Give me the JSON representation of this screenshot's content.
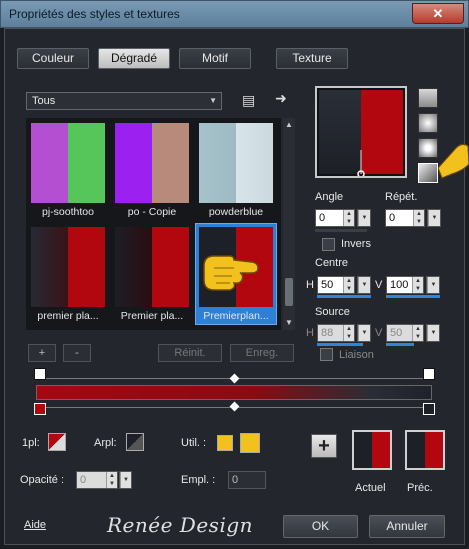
{
  "window": {
    "title": "Propriétés des styles et textures",
    "close_glyph": "✕"
  },
  "tabs": [
    {
      "label": "Couleur"
    },
    {
      "label": "Dégradé"
    },
    {
      "label": "Motif"
    },
    {
      "label": "Texture"
    }
  ],
  "category": {
    "selected": "Tous"
  },
  "swatches": [
    {
      "label": "pj-soothtoo"
    },
    {
      "label": "po - Copie"
    },
    {
      "label": "powderblue"
    },
    {
      "label": "premier pla..."
    },
    {
      "label": "Premier pla..."
    },
    {
      "label": "Premierplan..."
    }
  ],
  "list_buttons": {
    "add": "+",
    "remove": "-",
    "reinit": "Réinit.",
    "enreg": "Enreg."
  },
  "angle": {
    "label": "Angle",
    "value": "0"
  },
  "repet": {
    "label": "Répét.",
    "value": "0"
  },
  "invers": {
    "label": "Invers"
  },
  "centre": {
    "label": "Centre",
    "h_label": "H",
    "h_value": "50",
    "v_label": "V",
    "v_value": "100"
  },
  "source": {
    "label": "Source",
    "h_label": "H",
    "h_value": "88",
    "v_label": "V",
    "v_value": "50"
  },
  "liaison": {
    "label": "Liaison"
  },
  "stops": {
    "pl_label": "1pl:",
    "arpl_label": "Arpl:",
    "util_label": "Util. :",
    "opacite_label": "Opacité :",
    "opacite_value": "0",
    "empl_label": "Empl. :",
    "empl_value": "0"
  },
  "compare": {
    "plus": "+",
    "actuel": "Actuel",
    "prec": "Préc."
  },
  "footer": {
    "aide": "Aide",
    "brand": "Renée Design",
    "ok": "OK",
    "annuler": "Annuler"
  },
  "colors": {
    "red": "#b2070f",
    "dark": "#1d2027",
    "selection": "#2e7fd6",
    "yellow": "#f2c11e"
  }
}
